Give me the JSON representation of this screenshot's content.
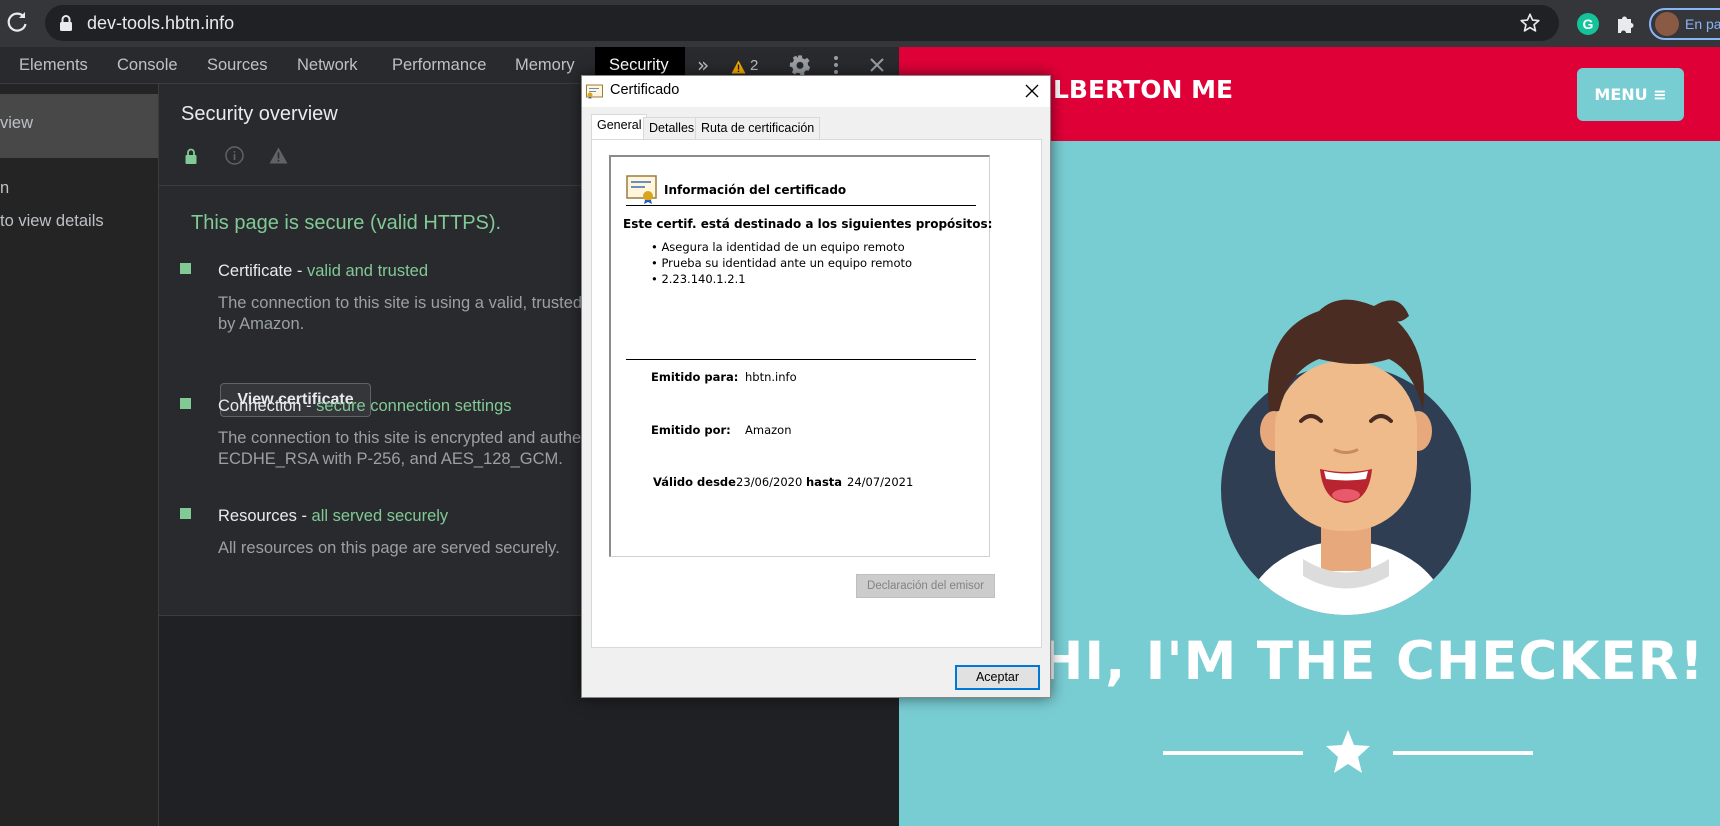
{
  "browser": {
    "url": "dev-tools.hbtn.info",
    "profile_label": "En pa",
    "grammarly_letter": "G",
    "icons": [
      "reload-icon",
      "lock-icon",
      "star-icon",
      "grammarly-icon",
      "extensions-icon",
      "avatar"
    ]
  },
  "devtools": {
    "tabs": [
      "Elements",
      "Console",
      "Sources",
      "Network",
      "Performance",
      "Memory",
      "Security"
    ],
    "active_tab": "Security",
    "more_tabs": "»",
    "warning_count": "2",
    "sidebar": {
      "overview_label": "view",
      "origin_label": "n",
      "details_hint": "to view details"
    },
    "security": {
      "title": "Security overview",
      "headline": "This page is secure (valid HTTPS).",
      "items": [
        {
          "label": "Certificate - ",
          "status": "valid and trusted",
          "desc_line1": "The connection to this site is using a valid, trusted",
          "desc_line2": "by Amazon.",
          "button": "View certificate"
        },
        {
          "label": "Connection - ",
          "status": "secure connection settings",
          "desc_line1": "The connection to this site is encrypted and authe",
          "desc_line2": "ECDHE_RSA with P-256, and AES_128_GCM."
        },
        {
          "label": "Resources - ",
          "status": "all served securely",
          "desc_line1": "All resources on this page are served securely."
        }
      ]
    },
    "colors": {
      "secure_green": "#81c995",
      "panel_bg": "#292a2d",
      "active_tab_bg": "#000000"
    }
  },
  "site": {
    "brand": "LBERTON ME",
    "menu_label": "MENU ≡",
    "hero_title": "HI, I'M THE CHECKER!",
    "colors": {
      "header": "#e00038",
      "background": "#78cdd3"
    }
  },
  "dialog": {
    "title": "Certificado",
    "tabs": [
      "General",
      "Detalles",
      "Ruta de certificación"
    ],
    "active_tab": "General",
    "info_title": "Información del certificado",
    "purpose_heading": "Este certif. está destinado a los siguientes propósitos:",
    "purposes": [
      "• Asegura la identidad de un equipo remoto",
      "• Prueba su identidad ante un equipo remoto",
      "• 2.23.140.1.2.1"
    ],
    "issued_to_label": "Emitido para:",
    "issued_to": "hbtn.info",
    "issued_by_label": "Emitido por:",
    "issued_by": "Amazon",
    "valid_from_label": "Válido desde",
    "valid_from": "23/06/2020",
    "valid_to_label": "hasta",
    "valid_to": "24/07/2021",
    "issuer_statement_button": "Declaración del emisor",
    "accept_button": "Aceptar"
  }
}
